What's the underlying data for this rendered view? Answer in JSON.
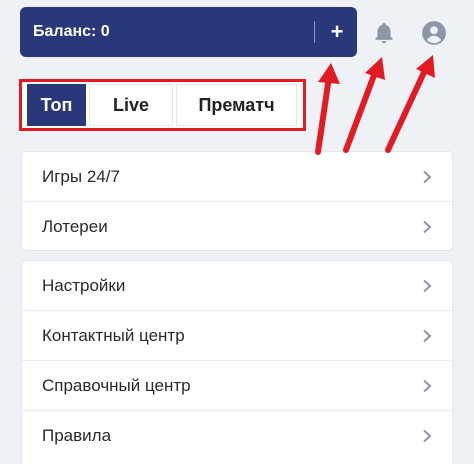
{
  "header": {
    "balance_label": "Баланс: 0",
    "add_label": "+"
  },
  "tabs": [
    {
      "label": "Топ",
      "active": true
    },
    {
      "label": "Live",
      "active": false
    },
    {
      "label": "Прематч",
      "active": false
    }
  ],
  "menu_group_1": [
    {
      "label": "Игры 24/7"
    },
    {
      "label": "Лотереи"
    }
  ],
  "menu_group_2": [
    {
      "label": "Настройки"
    },
    {
      "label": "Контактный центр"
    },
    {
      "label": "Справочный центр"
    },
    {
      "label": "Правила"
    }
  ],
  "colors": {
    "brand": "#293879",
    "highlight": "#e21b23",
    "icon": "#8d96a6"
  }
}
